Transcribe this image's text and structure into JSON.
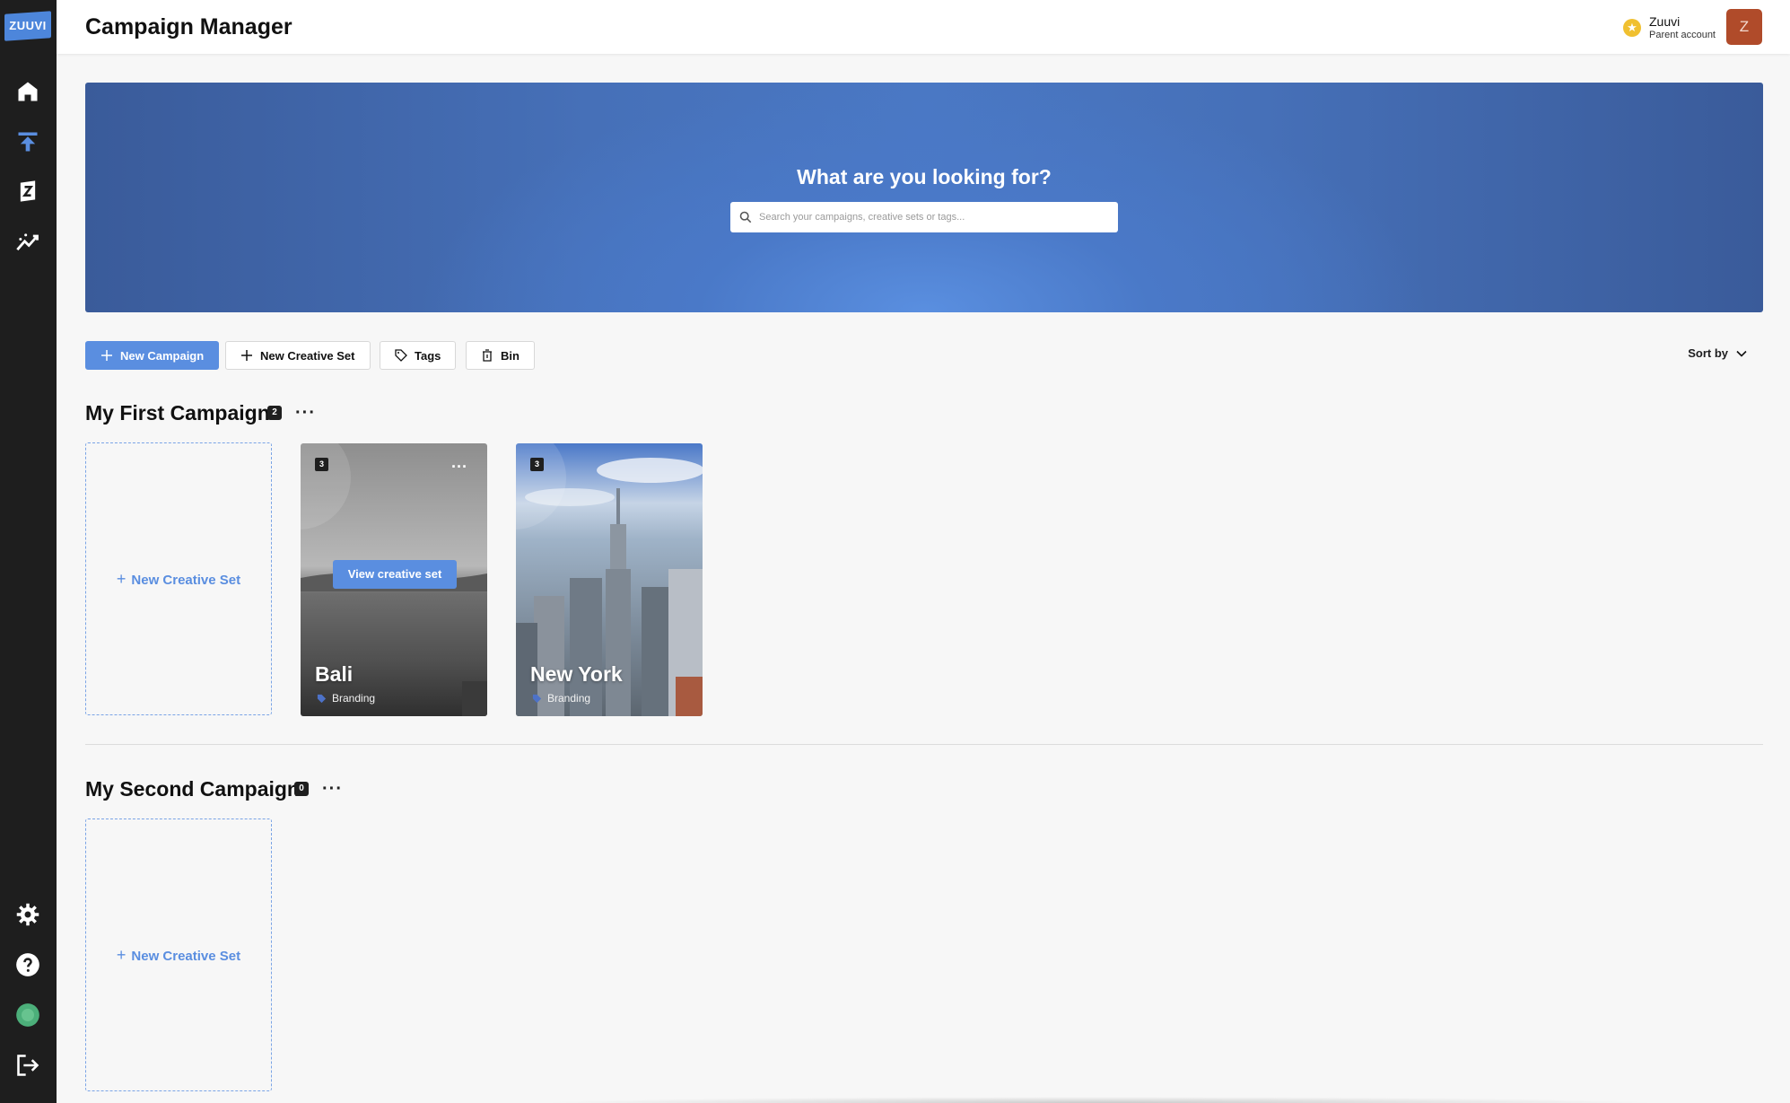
{
  "app": {
    "logo_text": "ZUUVI",
    "brand_color": "#4d86db"
  },
  "header": {
    "title": "Campaign Manager",
    "account_name": "Zuuvi",
    "account_type": "Parent account",
    "avatar_letter": "Z"
  },
  "sidebar": {
    "top_items": [
      {
        "icon": "home-icon"
      },
      {
        "icon": "upload-icon"
      },
      {
        "icon": "zuuvi-badge-icon"
      },
      {
        "icon": "analytics-icon"
      }
    ],
    "bottom_items": [
      {
        "icon": "gear-icon"
      },
      {
        "icon": "help-icon"
      },
      {
        "icon": "status-dot-icon"
      },
      {
        "icon": "logout-icon"
      }
    ]
  },
  "hero": {
    "title": "What are you looking for?",
    "search_placeholder": "Search your campaigns, creative sets or tags..."
  },
  "toolbar": {
    "new_campaign": "New Campaign",
    "new_creative_set": "New Creative Set",
    "tags": "Tags",
    "bin": "Bin",
    "sort_by": "Sort by"
  },
  "campaigns": [
    {
      "name": "My First Campaign",
      "count": "2",
      "new_set_label": "New Creative Set",
      "sets": [
        {
          "name": "Bali",
          "count": "3",
          "tag": "Branding",
          "hover_action": "View creative set",
          "more": "···"
        },
        {
          "name": "New York",
          "count": "3",
          "tag": "Branding"
        }
      ]
    },
    {
      "name": "My Second Campaign",
      "count": "0",
      "new_set_label": "New Creative Set",
      "sets": []
    }
  ],
  "more_glyph": "···"
}
